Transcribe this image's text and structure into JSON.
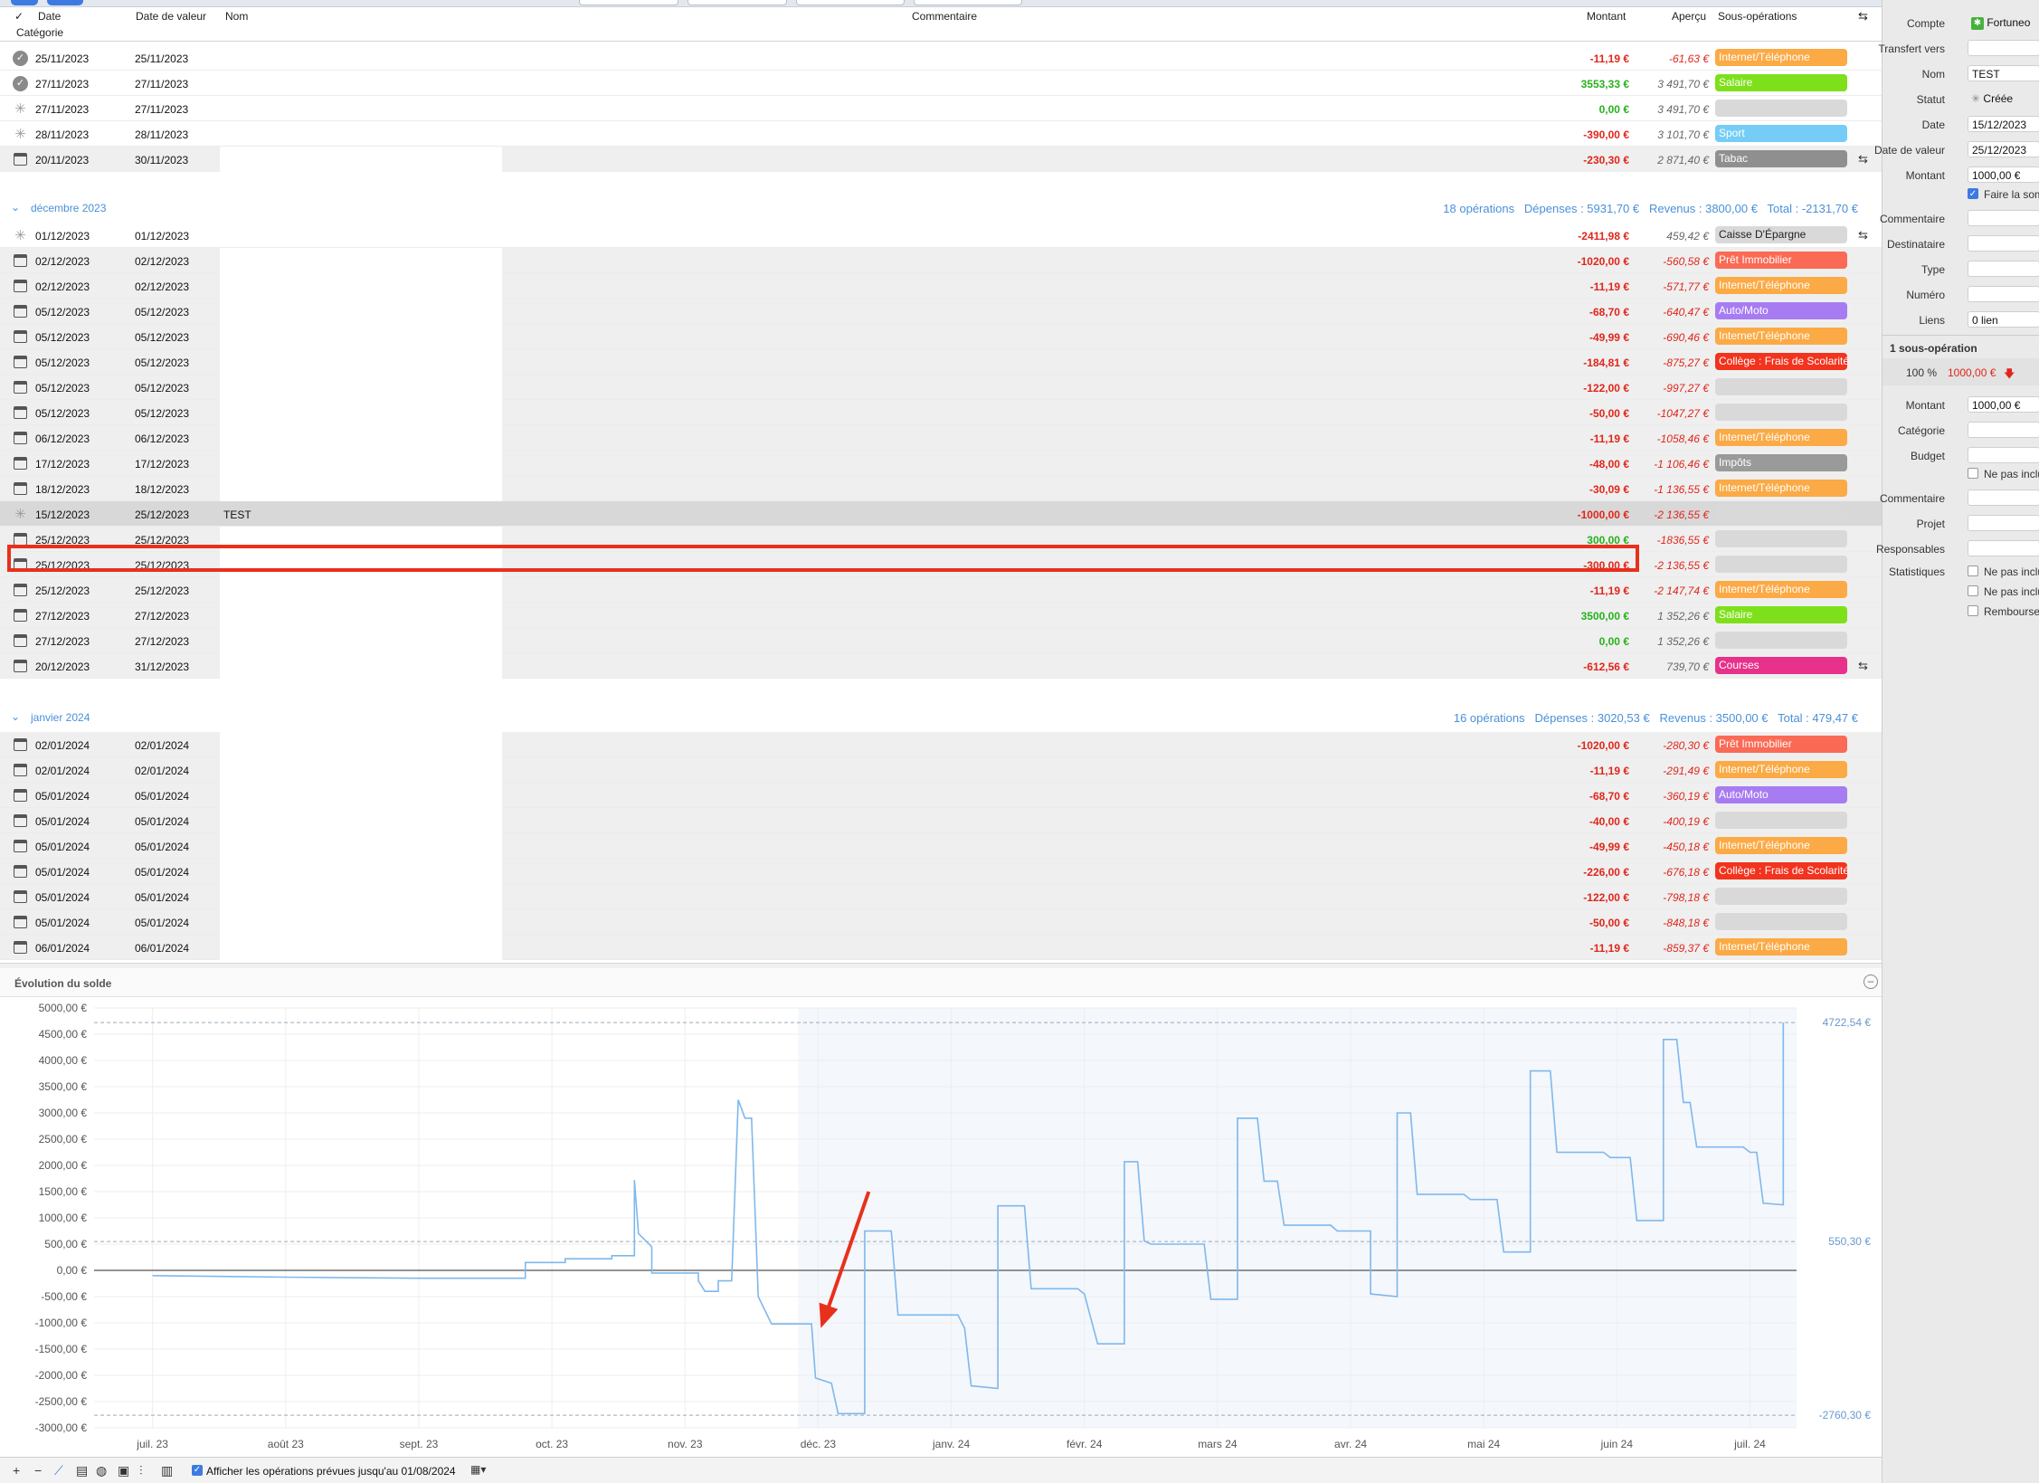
{
  "header": {
    "check": "✓",
    "date": "Date",
    "value_date": "Date de valeur",
    "name": "Nom",
    "comment": "Commentaire",
    "amount": "Montant",
    "preview": "Aperçu",
    "subops": "Sous-opérations",
    "category": "Catégorie"
  },
  "rows_nov": [
    {
      "d1": "25/11/2023",
      "d2": "25/11/2023",
      "name": "",
      "amount": "-11,19 €",
      "sign": "neg",
      "preview": "-61,63 €",
      "pneg": true,
      "tag": "Internet/Téléphone",
      "tagc": "#fbaa45",
      "icon": "check",
      "grey": false
    },
    {
      "d1": "27/11/2023",
      "d2": "27/11/2023",
      "name": "",
      "amount": "3553,33 €",
      "sign": "pos",
      "preview": "3 491,70 €",
      "pneg": false,
      "tag": "Salaire",
      "tagc": "#7ee01a",
      "icon": "check",
      "grey": false
    },
    {
      "d1": "27/11/2023",
      "d2": "27/11/2023",
      "name": "",
      "amount": "0,00 €",
      "sign": "pos",
      "preview": "3 491,70 €",
      "pneg": false,
      "tag": "",
      "tagc": "",
      "icon": "spin",
      "grey": false
    },
    {
      "d1": "28/11/2023",
      "d2": "28/11/2023",
      "name": "",
      "amount": "-390,00 €",
      "sign": "neg",
      "preview": "3 101,70 €",
      "pneg": false,
      "tag": "Sport",
      "tagc": "#75cdf7",
      "icon": "spin",
      "grey": false
    },
    {
      "d1": "20/11/2023",
      "d2": "30/11/2023",
      "name": "",
      "amount": "-230,30 €",
      "sign": "neg",
      "preview": "2 871,40 €",
      "pneg": false,
      "tag": "Tabac",
      "tagc": "#8f8f8f",
      "icon": "cal",
      "grey": true,
      "cog": true
    }
  ],
  "dec": {
    "title": "décembre 2023",
    "summary": "18 opérations   Dépenses : 5931,70 €   Revenus : 3800,00 €   Total : -2131,70 €"
  },
  "rows_dec": [
    {
      "d1": "01/12/2023",
      "d2": "01/12/2023",
      "name": "",
      "amount": "-2411,98 €",
      "sign": "neg",
      "preview": "459,42 €",
      "pneg": false,
      "tag": "Caisse D'Épargne",
      "tagc": "#d9d9d9",
      "dark": true,
      "icon": "spin",
      "grey": false,
      "cog": true
    },
    {
      "d1": "02/12/2023",
      "d2": "02/12/2023",
      "name": "",
      "amount": "-1020,00 €",
      "sign": "neg",
      "preview": "-560,58 €",
      "pneg": true,
      "tag": "Prêt Immobilier",
      "tagc": "#fa6a55",
      "icon": "cal",
      "grey": true
    },
    {
      "d1": "02/12/2023",
      "d2": "02/12/2023",
      "name": "",
      "amount": "-11,19 €",
      "sign": "neg",
      "preview": "-571,77 €",
      "pneg": true,
      "tag": "Internet/Téléphone",
      "tagc": "#fbaa45",
      "icon": "cal",
      "grey": true
    },
    {
      "d1": "05/12/2023",
      "d2": "05/12/2023",
      "name": "",
      "amount": "-68,70 €",
      "sign": "neg",
      "preview": "-640,47 €",
      "pneg": true,
      "tag": "Auto/Moto",
      "tagc": "#a77cf2",
      "icon": "cal",
      "grey": true
    },
    {
      "d1": "05/12/2023",
      "d2": "05/12/2023",
      "name": "",
      "amount": "-49,99 €",
      "sign": "neg",
      "preview": "-690,46 €",
      "pneg": true,
      "tag": "Internet/Téléphone",
      "tagc": "#fbaa45",
      "icon": "cal",
      "grey": true
    },
    {
      "d1": "05/12/2023",
      "d2": "05/12/2023",
      "name": "",
      "amount": "-184,81 €",
      "sign": "neg",
      "preview": "-875,27 €",
      "pneg": true,
      "tag": "Collège : Frais de Scolarité",
      "tagc": "#f2331e",
      "icon": "cal",
      "grey": true
    },
    {
      "d1": "05/12/2023",
      "d2": "05/12/2023",
      "name": "",
      "amount": "-122,00 €",
      "sign": "neg",
      "preview": "-997,27 €",
      "pneg": true,
      "tag": "",
      "tagc": "",
      "icon": "cal",
      "grey": true
    },
    {
      "d1": "05/12/2023",
      "d2": "05/12/2023",
      "name": "",
      "amount": "-50,00 €",
      "sign": "neg",
      "preview": "-1047,27 €",
      "pneg": true,
      "tag": "",
      "tagc": "",
      "icon": "cal",
      "grey": true
    },
    {
      "d1": "06/12/2023",
      "d2": "06/12/2023",
      "name": "",
      "amount": "-11,19 €",
      "sign": "neg",
      "preview": "-1058,46 €",
      "pneg": true,
      "tag": "Internet/Téléphone",
      "tagc": "#fbaa45",
      "icon": "cal",
      "grey": true
    },
    {
      "d1": "17/12/2023",
      "d2": "17/12/2023",
      "name": "",
      "amount": "-48,00 €",
      "sign": "neg",
      "preview": "-1 106,46 €",
      "pneg": true,
      "tag": "Impôts",
      "tagc": "#9a9a9a",
      "icon": "cal",
      "grey": true
    },
    {
      "d1": "18/12/2023",
      "d2": "18/12/2023",
      "name": "",
      "amount": "-30,09 €",
      "sign": "neg",
      "preview": "-1 136,55 €",
      "pneg": true,
      "tag": "Internet/Téléphone",
      "tagc": "#fbaa45",
      "icon": "cal",
      "grey": true
    },
    {
      "d1": "15/12/2023",
      "d2": "25/12/2023",
      "name": "TEST",
      "amount": "-1000,00 €",
      "sign": "neg",
      "preview": "-2 136,55 €",
      "pneg": true,
      "tag": "",
      "tagc": "",
      "icon": "spin",
      "grey": true,
      "sel": true
    },
    {
      "d1": "25/12/2023",
      "d2": "25/12/2023",
      "name": "",
      "amount": "300,00 €",
      "sign": "pos",
      "preview": "-1836,55 €",
      "pneg": true,
      "tag": "",
      "tagc": "",
      "icon": "cal",
      "grey": true
    },
    {
      "d1": "25/12/2023",
      "d2": "25/12/2023",
      "name": "",
      "amount": "-300,00 €",
      "sign": "neg",
      "preview": "-2 136,55 €",
      "pneg": true,
      "tag": "",
      "tagc": "",
      "icon": "cal",
      "grey": true
    },
    {
      "d1": "25/12/2023",
      "d2": "25/12/2023",
      "name": "",
      "amount": "-11,19 €",
      "sign": "neg",
      "preview": "-2 147,74 €",
      "pneg": true,
      "tag": "Internet/Téléphone",
      "tagc": "#fbaa45",
      "icon": "cal",
      "grey": true
    },
    {
      "d1": "27/12/2023",
      "d2": "27/12/2023",
      "name": "",
      "amount": "3500,00 €",
      "sign": "pos",
      "preview": "1 352,26 €",
      "pneg": false,
      "tag": "Salaire",
      "tagc": "#7ee01a",
      "icon": "cal",
      "grey": true
    },
    {
      "d1": "27/12/2023",
      "d2": "27/12/2023",
      "name": "",
      "amount": "0,00 €",
      "sign": "pos",
      "preview": "1 352,26 €",
      "pneg": false,
      "tag": "",
      "tagc": "",
      "icon": "cal",
      "grey": true
    },
    {
      "d1": "20/12/2023",
      "d2": "31/12/2023",
      "name": "",
      "amount": "-612,56 €",
      "sign": "neg",
      "preview": "739,70 €",
      "pneg": false,
      "tag": "Courses",
      "tagc": "#e8318a",
      "icon": "cal",
      "grey": true,
      "cog": true
    }
  ],
  "jan": {
    "title": "janvier 2024",
    "summary": "16 opérations   Dépenses : 3020,53 €   Revenus : 3500,00 €   Total : 479,47 €"
  },
  "rows_jan": [
    {
      "d1": "02/01/2024",
      "d2": "02/01/2024",
      "name": "",
      "amount": "-1020,00 €",
      "sign": "neg",
      "preview": "-280,30 €",
      "pneg": true,
      "tag": "Prêt Immobilier",
      "tagc": "#fa6a55",
      "icon": "cal",
      "grey": true
    },
    {
      "d1": "02/01/2024",
      "d2": "02/01/2024",
      "name": "",
      "amount": "-11,19 €",
      "sign": "neg",
      "preview": "-291,49 €",
      "pneg": true,
      "tag": "Internet/Téléphone",
      "tagc": "#fbaa45",
      "icon": "cal",
      "grey": true
    },
    {
      "d1": "05/01/2024",
      "d2": "05/01/2024",
      "name": "",
      "amount": "-68,70 €",
      "sign": "neg",
      "preview": "-360,19 €",
      "pneg": true,
      "tag": "Auto/Moto",
      "tagc": "#a77cf2",
      "icon": "cal",
      "grey": true
    },
    {
      "d1": "05/01/2024",
      "d2": "05/01/2024",
      "name": "",
      "amount": "-40,00 €",
      "sign": "neg",
      "preview": "-400,19 €",
      "pneg": true,
      "tag": "",
      "tagc": "",
      "icon": "cal",
      "grey": true
    },
    {
      "d1": "05/01/2024",
      "d2": "05/01/2024",
      "name": "",
      "amount": "-49,99 €",
      "sign": "neg",
      "preview": "-450,18 €",
      "pneg": true,
      "tag": "Internet/Téléphone",
      "tagc": "#fbaa45",
      "icon": "cal",
      "grey": true
    },
    {
      "d1": "05/01/2024",
      "d2": "05/01/2024",
      "name": "",
      "amount": "-226,00 €",
      "sign": "neg",
      "preview": "-676,18 €",
      "pneg": true,
      "tag": "Collège : Frais de Scolarité",
      "tagc": "#f2331e",
      "icon": "cal",
      "grey": true
    },
    {
      "d1": "05/01/2024",
      "d2": "05/01/2024",
      "name": "",
      "amount": "-122,00 €",
      "sign": "neg",
      "preview": "-798,18 €",
      "pneg": true,
      "tag": "",
      "tagc": "",
      "icon": "cal",
      "grey": true
    },
    {
      "d1": "05/01/2024",
      "d2": "05/01/2024",
      "name": "",
      "amount": "-50,00 €",
      "sign": "neg",
      "preview": "-848,18 €",
      "pneg": true,
      "tag": "",
      "tagc": "",
      "icon": "cal",
      "grey": true
    },
    {
      "d1": "06/01/2024",
      "d2": "06/01/2024",
      "name": "",
      "amount": "-11,19 €",
      "sign": "neg",
      "preview": "-859,37 €",
      "pneg": true,
      "tag": "Internet/Téléphone",
      "tagc": "#fbaa45",
      "icon": "cal",
      "grey": true
    }
  ],
  "chart_data": {
    "type": "line",
    "title": "Évolution du solde",
    "yticks": [
      "5000,00 €",
      "4500,00 €",
      "4000,00 €",
      "3500,00 €",
      "3000,00 €",
      "2500,00 €",
      "2000,00 €",
      "1500,00 €",
      "1000,00 €",
      "500,00 €",
      "0,00 €",
      "-500,00 €",
      "-1000,00 €",
      "-1500,00 €",
      "-2000,00 €",
      "-2500,00 €",
      "-3000,00 €"
    ],
    "ylim": [
      -3000,
      5000
    ],
    "xticks": [
      "juil. 23",
      "août 23",
      "sept. 23",
      "oct. 23",
      "nov. 23",
      "déc. 23",
      "janv. 24",
      "févr. 24",
      "mars 24",
      "avr. 24",
      "mai 24",
      "juin 24",
      "juil. 24"
    ],
    "ref_lines": [
      {
        "value": 4722.54,
        "label": "4722,54 €"
      },
      {
        "value": 550.3,
        "label": "550,30 €"
      },
      {
        "value": -2760.3,
        "label": "-2760,30 €"
      }
    ],
    "forecast_start_month": 4.85,
    "series": [
      {
        "color": "#7fb8ec",
        "points": [
          [
            0,
            -100
          ],
          [
            1,
            -130
          ],
          [
            2,
            -150
          ],
          [
            2.8,
            -150
          ],
          [
            2.8,
            150
          ],
          [
            3.1,
            150
          ],
          [
            3.1,
            220
          ],
          [
            3.45,
            220
          ],
          [
            3.45,
            280
          ],
          [
            3.62,
            280
          ],
          [
            3.62,
            1720
          ],
          [
            3.65,
            700
          ],
          [
            3.75,
            450
          ],
          [
            3.75,
            -50
          ],
          [
            4.1,
            -50
          ],
          [
            4.1,
            -200
          ],
          [
            4.15,
            -400
          ],
          [
            4.25,
            -400
          ],
          [
            4.25,
            -200
          ],
          [
            4.35,
            -200
          ],
          [
            4.4,
            3250
          ],
          [
            4.45,
            2900
          ],
          [
            4.5,
            2900
          ],
          [
            4.55,
            -500
          ],
          [
            4.65,
            -1020
          ],
          [
            4.95,
            -1020
          ],
          [
            4.98,
            -2050
          ],
          [
            5.1,
            -2150
          ],
          [
            5.15,
            -2730
          ],
          [
            5.35,
            -2730
          ],
          [
            5.35,
            750
          ],
          [
            5.55,
            750
          ],
          [
            5.6,
            -850
          ],
          [
            6.05,
            -850
          ],
          [
            6.1,
            -1100
          ],
          [
            6.15,
            -2200
          ],
          [
            6.35,
            -2250
          ],
          [
            6.35,
            1230
          ],
          [
            6.55,
            1230
          ],
          [
            6.6,
            -350
          ],
          [
            6.95,
            -350
          ],
          [
            7,
            -450
          ],
          [
            7.1,
            -1400
          ],
          [
            7.3,
            -1400
          ],
          [
            7.3,
            2070
          ],
          [
            7.4,
            2070
          ],
          [
            7.45,
            560
          ],
          [
            7.5,
            500
          ],
          [
            7.9,
            500
          ],
          [
            7.95,
            -550
          ],
          [
            8.15,
            -550
          ],
          [
            8.15,
            2900
          ],
          [
            8.3,
            2900
          ],
          [
            8.35,
            1700
          ],
          [
            8.45,
            1700
          ],
          [
            8.5,
            860
          ],
          [
            8.85,
            860
          ],
          [
            8.9,
            750
          ],
          [
            9.15,
            750
          ],
          [
            9.15,
            -450
          ],
          [
            9.35,
            -500
          ],
          [
            9.35,
            3000
          ],
          [
            9.45,
            3000
          ],
          [
            9.5,
            1450
          ],
          [
            9.85,
            1450
          ],
          [
            9.9,
            1350
          ],
          [
            10.1,
            1350
          ],
          [
            10.15,
            350
          ],
          [
            10.35,
            350
          ],
          [
            10.35,
            3800
          ],
          [
            10.5,
            3800
          ],
          [
            10.55,
            2250
          ],
          [
            10.9,
            2250
          ],
          [
            10.95,
            2150
          ],
          [
            11.1,
            2150
          ],
          [
            11.15,
            950
          ],
          [
            11.35,
            950
          ],
          [
            11.35,
            4400
          ],
          [
            11.45,
            4400
          ],
          [
            11.5,
            3200
          ],
          [
            11.55,
            3200
          ],
          [
            11.6,
            2350
          ],
          [
            11.95,
            2350
          ],
          [
            12,
            2250
          ],
          [
            12.05,
            2250
          ],
          [
            12.1,
            1280
          ],
          [
            12.25,
            1250
          ],
          [
            12.25,
            4722
          ]
        ]
      }
    ]
  },
  "right_panel": {
    "compte_label": "Compte",
    "compte_value": "Fortuneo",
    "transfert_label": "Transfert vers",
    "transfert_value": "",
    "nom_label": "Nom",
    "nom_value": "TEST",
    "statut_label": "Statut",
    "statut_value": "Créée",
    "date_label": "Date",
    "date_value": "15/12/2023",
    "dv_label": "Date de valeur",
    "dv_value": "25/12/2023",
    "montant_label": "Montant",
    "montant_value": "1000,00 €",
    "somme_label": "Faire la somme",
    "commentaire_label": "Commentaire",
    "destinataire_label": "Destinataire",
    "type_label": "Type",
    "numero_label": "Numéro",
    "liens_label": "Liens",
    "liens_value": "0 lien",
    "subop_title": "1 sous-opération",
    "subop_pct": "100 %",
    "subop_amount": "1000,00 €",
    "sm_label": "Montant",
    "sm_value": "1000,00 €",
    "cat_label": "Catégorie",
    "budget_label": "Budget",
    "ne_pas_inclure": "Ne pas inclure",
    "commentaire2_label": "Commentaire",
    "projet_label": "Projet",
    "responsables_label": "Responsables",
    "stats_label": "Statistiques",
    "rembourser": "Rembourser"
  },
  "bottom": {
    "show_forecast": "Afficher les opérations prévues jusqu'au 01/08/2024"
  }
}
